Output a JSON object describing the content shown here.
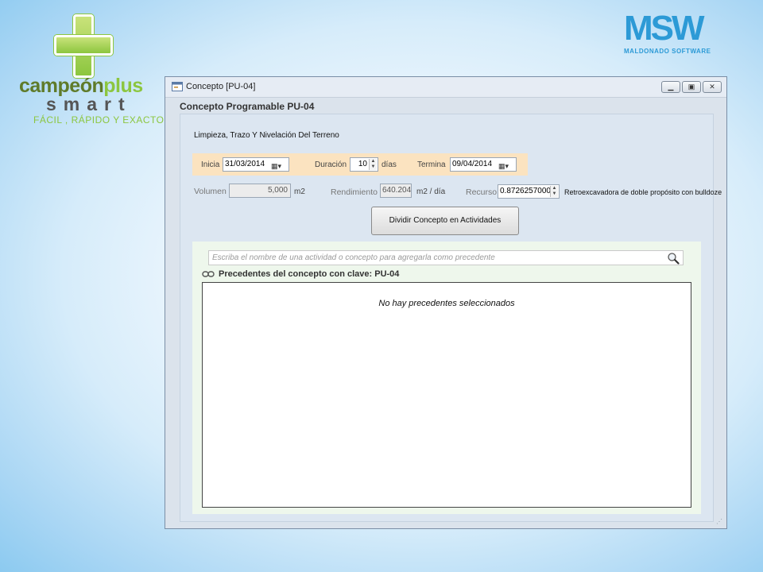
{
  "branding": {
    "left_logo_main": "campeón",
    "left_logo_plus": "plus",
    "left_logo_smart": "smart",
    "left_logo_tagline": "FÁCIL , RÁPIDO Y EXACTO",
    "right_logo_main": "MSW",
    "right_logo_sub": "MALDONADO SOFTWARE"
  },
  "window": {
    "title": "Concepto [PU-04]",
    "controls": [
      "minimize-icon",
      "maximize-icon",
      "close-icon"
    ]
  },
  "form": {
    "title": "Concepto Programable PU-04",
    "description": "Limpieza, Trazo Y Nivelación Del Terreno",
    "inicia_label": "Inicia",
    "inicia_value": "31/03/2014",
    "duracion_label": "Duración",
    "duracion_value": "10",
    "duracion_unit": "días",
    "termina_label": "Termina",
    "termina_value": "09/04/2014",
    "volumen_label": "Volumen",
    "volumen_value": "5,000",
    "volumen_unit": "m2",
    "rendimiento_label": "Rendimiento",
    "rendimiento_value": "640.204",
    "rendimiento_unit": "m2 / día",
    "recurso_label": "Recurso",
    "recurso_value": "0.8726257000",
    "recurso_desc": "Retroexcavadora de doble propósito con bulldoze",
    "divide_button": "Dividir Concepto en Actividades"
  },
  "precedents": {
    "search_placeholder": "Escriba el nombre de una actividad o concepto para agregarla como precedente",
    "title": "Precedentes del concepto con clave: PU-04",
    "empty_message": "No hay precedentes seleccionados"
  },
  "colors": {
    "accent_green": "#8cc63f",
    "accent_blue": "#2c9ad6",
    "dates_bar": "#fbe3c0",
    "precedents_area": "#eef7ec"
  }
}
